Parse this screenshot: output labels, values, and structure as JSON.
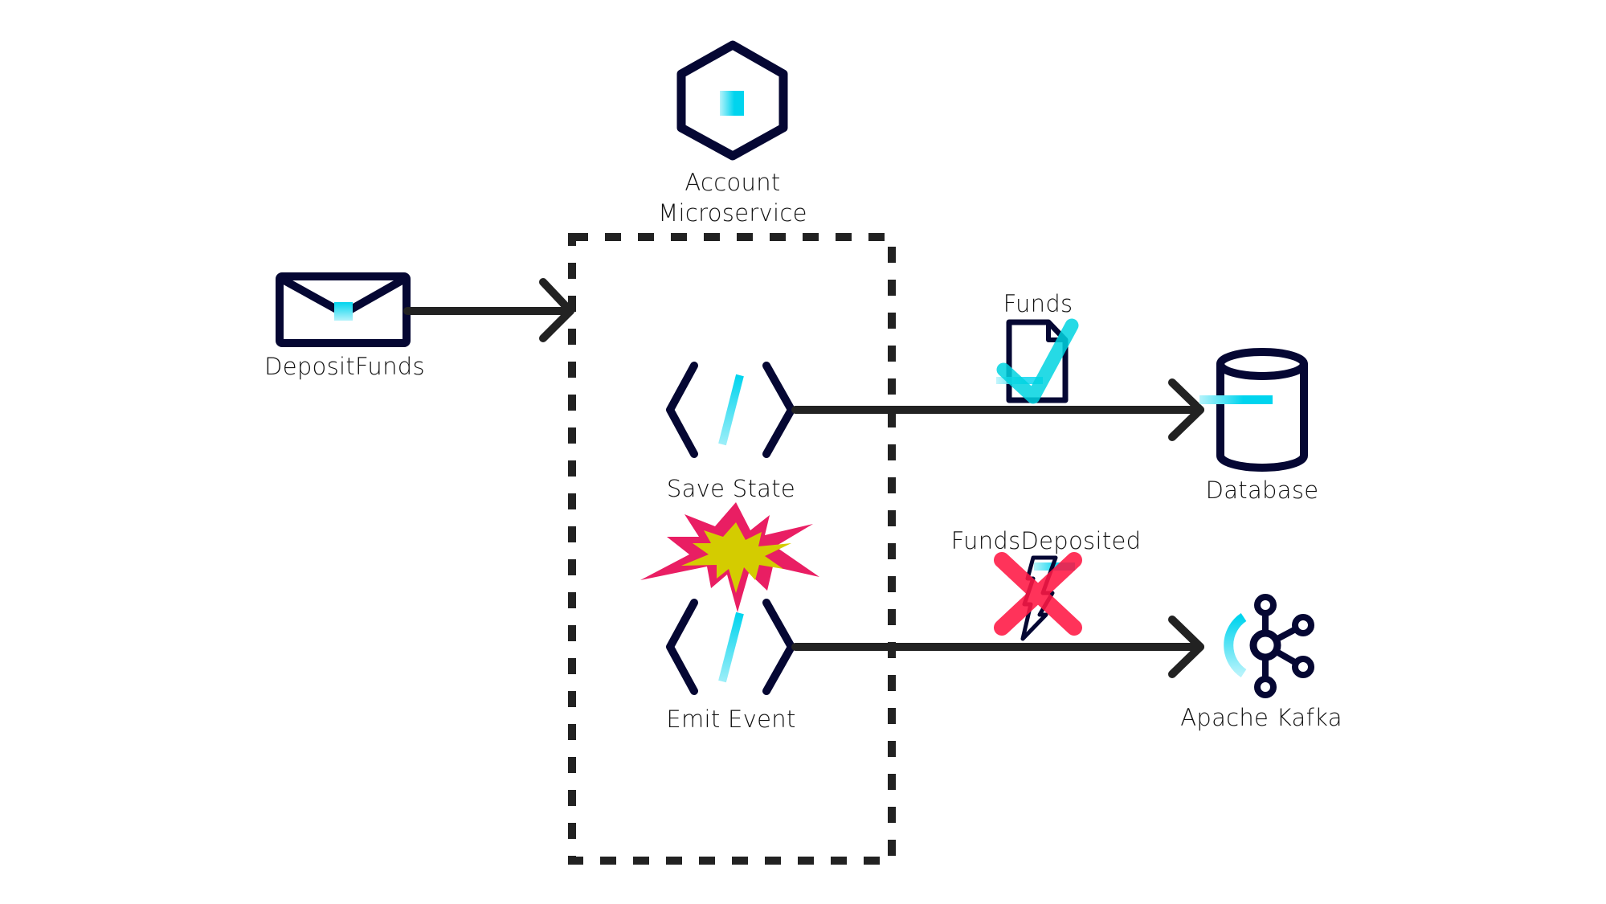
{
  "diagram": {
    "container": {
      "label_line1": "Account",
      "label_line2": "Microservice",
      "icon": "hexagon-microservice-icon",
      "border_style": "dashed"
    },
    "nodes": {
      "command": {
        "label": "DepositFunds",
        "icon": "envelope-icon"
      },
      "save_state": {
        "label": "Save State",
        "icon": "code-icon"
      },
      "emit_event": {
        "label": "Emit Event",
        "icon": "code-icon"
      },
      "database": {
        "label": "Database",
        "icon": "database-cylinder-icon"
      },
      "kafka": {
        "label": "Apache Kafka",
        "icon": "kafka-icon"
      }
    },
    "edges": [
      {
        "from": "DepositFunds",
        "to": "Account Microservice",
        "label": ""
      },
      {
        "from": "Save State",
        "to": "Database",
        "label": "Funds",
        "status": "success",
        "status_icon": "checkmark-icon",
        "payload_icon": "document-icon"
      },
      {
        "from": "Emit Event",
        "to": "Apache Kafka",
        "label": "FundsDeposited",
        "status": "failed",
        "status_icon": "red-x-icon",
        "payload_icon": "lightning-event-icon"
      }
    ],
    "failure_marker": {
      "icon": "explosion-icon",
      "between": [
        "Save State",
        "Emit Event"
      ]
    },
    "colors": {
      "icon_stroke": "#050733",
      "accent_cyan": "#00D4EE",
      "arrow": "#222222",
      "error_red": "#FF1744",
      "explosion_outer": "#E91E63",
      "explosion_inner": "#D4CC00"
    }
  }
}
